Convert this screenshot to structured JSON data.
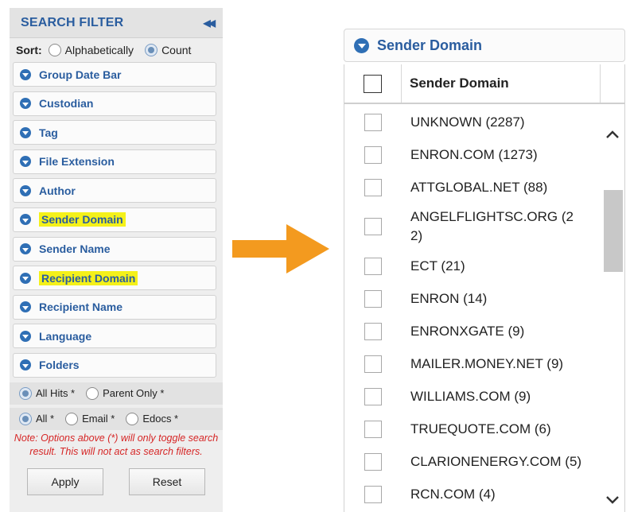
{
  "search_filter": {
    "title": "SEARCH FILTER",
    "collapse_icon": "double-chevron-left-icon",
    "sort": {
      "label": "Sort:",
      "options": [
        "Alphabetically",
        "Count"
      ],
      "selected": "Count"
    },
    "filters": [
      {
        "label": "Group Date Bar",
        "highlighted": false
      },
      {
        "label": "Custodian",
        "highlighted": false
      },
      {
        "label": "Tag",
        "highlighted": false
      },
      {
        "label": "File Extension",
        "highlighted": false
      },
      {
        "label": "Author",
        "highlighted": false
      },
      {
        "label": "Sender Domain",
        "highlighted": true
      },
      {
        "label": "Sender Name",
        "highlighted": false
      },
      {
        "label": "Recipient Domain",
        "highlighted": true
      },
      {
        "label": "Recipient Name",
        "highlighted": false
      },
      {
        "label": "Language",
        "highlighted": false
      },
      {
        "label": "Folders",
        "highlighted": false
      }
    ],
    "hits_options": {
      "all_hits": "All Hits *",
      "parent_only": "Parent Only *",
      "selected": "All Hits *"
    },
    "type_options": {
      "all": "All *",
      "email": "Email *",
      "edocs": "Edocs *",
      "selected": "All *"
    },
    "note": "Note: Options above (*) will only toggle search result. This will not act as search filters.",
    "apply_label": "Apply",
    "reset_label": "Reset"
  },
  "sender_domain_panel": {
    "title": "Sender Domain",
    "column_header": "Sender Domain",
    "rows": [
      "UNKNOWN (2287)",
      "ENRON.COM (1273)",
      "ATTGLOBAL.NET (88)",
      "ANGELFLIGHTSC.ORG (2\n2)",
      "ECT (21)",
      "ENRON (14)",
      "ENRONXGATE (9)",
      "MAILER.MONEY.NET (9)",
      "WILLIAMS.COM (9)",
      "TRUEQUOTE.COM (6)",
      "CLARIONENERGY.COM (5)",
      "RCN.COM (4)"
    ]
  },
  "colors": {
    "accent_blue": "#2a5d9f",
    "icon_blue": "#2f6fb5",
    "highlight_yellow": "#f4f11a",
    "note_red": "#d62626",
    "arrow_orange": "#f39a1f"
  }
}
